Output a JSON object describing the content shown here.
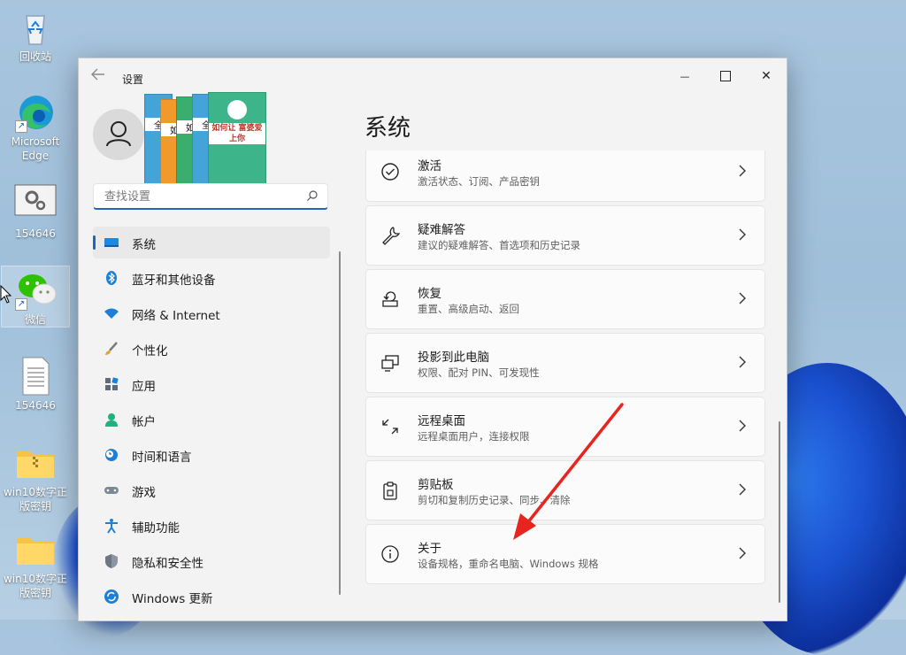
{
  "desktop": {
    "icons": [
      {
        "label": "回收站",
        "icon": "recycle-bin-icon"
      },
      {
        "label": "Microsoft Edge",
        "icon": "edge-icon"
      },
      {
        "label": "154646",
        "icon": "settings-shortcut-icon"
      },
      {
        "label": "微信",
        "icon": "wechat-icon"
      },
      {
        "label": "154646",
        "icon": "text-file-icon"
      },
      {
        "label": "win10数字正版密钥",
        "icon": "zip-folder-icon"
      },
      {
        "label": "win10数字正版密钥",
        "icon": "folder-icon"
      }
    ]
  },
  "window": {
    "title": "设置",
    "back_icon": "back-arrow-icon",
    "controls": {
      "minimize": "—",
      "close": "✕"
    }
  },
  "ad": {
    "books": [
      "全",
      "如",
      "如",
      "全",
      "如何让 富婆爱上你"
    ]
  },
  "search": {
    "placeholder": "查找设置",
    "icon": "search-icon"
  },
  "nav": {
    "items": [
      {
        "label": "系统",
        "icon": "monitor-icon",
        "active": true
      },
      {
        "label": "蓝牙和其他设备",
        "icon": "bluetooth-icon"
      },
      {
        "label": "网络 & Internet",
        "icon": "wifi-icon"
      },
      {
        "label": "个性化",
        "icon": "brush-icon"
      },
      {
        "label": "应用",
        "icon": "apps-icon"
      },
      {
        "label": "帐户",
        "icon": "account-icon"
      },
      {
        "label": "时间和语言",
        "icon": "clock-globe-icon"
      },
      {
        "label": "游戏",
        "icon": "gamepad-icon"
      },
      {
        "label": "辅助功能",
        "icon": "accessibility-icon"
      },
      {
        "label": "隐私和安全性",
        "icon": "shield-icon"
      },
      {
        "label": "Windows 更新",
        "icon": "update-icon"
      }
    ]
  },
  "main": {
    "title": "系统",
    "cards": [
      {
        "title": "激活",
        "subtitle": "激活状态、订阅、产品密钥",
        "icon": "check-circle-icon"
      },
      {
        "title": "疑难解答",
        "subtitle": "建议的疑难解答、首选项和历史记录",
        "icon": "wrench-icon"
      },
      {
        "title": "恢复",
        "subtitle": "重置、高级启动、返回",
        "icon": "recovery-icon"
      },
      {
        "title": "投影到此电脑",
        "subtitle": "权限、配对 PIN、可发现性",
        "icon": "project-icon"
      },
      {
        "title": "远程桌面",
        "subtitle": "远程桌面用户，连接权限",
        "icon": "remote-desktop-icon"
      },
      {
        "title": "剪贴板",
        "subtitle": "剪切和复制历史记录、同步、清除",
        "icon": "clipboard-icon"
      },
      {
        "title": "关于",
        "subtitle": "设备规格，重命名电脑、Windows 规格",
        "icon": "info-icon"
      }
    ]
  },
  "colors": {
    "accent": "#1d65c1",
    "annotation_arrow": "#e8241f"
  }
}
